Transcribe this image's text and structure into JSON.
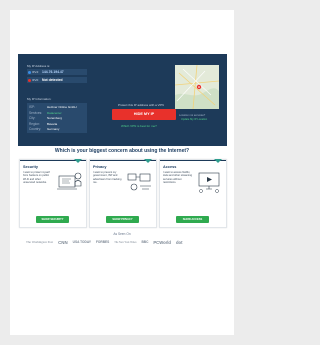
{
  "hero": {
    "ip_label": "My IP Address is:",
    "ip_prefix": "IPv4:",
    "ip_value": "144.76.194.47",
    "ipv6_prefix": "IPv6:",
    "ipv6_value": "Not detected",
    "info_label": "My IP Information:",
    "info_rows": [
      {
        "k": "ISP:",
        "v": "Hetzner Online GmbH"
      },
      {
        "k": "Services:",
        "v": "Datacenter"
      },
      {
        "k": "City:",
        "v": "Nuremberg"
      },
      {
        "k": "Region:",
        "v": "Bavaria"
      },
      {
        "k": "Country:",
        "v": "Germany"
      }
    ],
    "protect_text": "Protect this IP address with a VPN",
    "cta_label": "HIDE MY IP",
    "cta_subtext": "Which VPN is best for me?",
    "map_caption": "Location not accurate?",
    "map_link": "Update My IP Location"
  },
  "heading": "Which is your biggest concern about using the Internet?",
  "cards": [
    {
      "title": "Security",
      "desc": "I want to protect myself from hackers on public Wi-Fi and other unsecured networks.",
      "button": "SHOW SECURITY"
    },
    {
      "title": "Privacy",
      "desc": "I want to prevent my government, ISP and advertisers from tracking me.",
      "button": "SHOW PRIVACY"
    },
    {
      "title": "Access",
      "desc": "I want to access Netflix, Hulu and other streaming services without restrictions.",
      "button": "SHOW ACCESS"
    }
  ],
  "as_seen": "As Seen On",
  "logos": [
    "The Washington Post",
    "CNN",
    "USA TODAY",
    "FORBES",
    "The New York Times",
    "BBC",
    "PCWorld",
    "dot"
  ],
  "colors": {
    "navy": "#1d3a59",
    "red": "#e8312b",
    "green": "#2faa4f",
    "teal": "#2e9d8e"
  }
}
